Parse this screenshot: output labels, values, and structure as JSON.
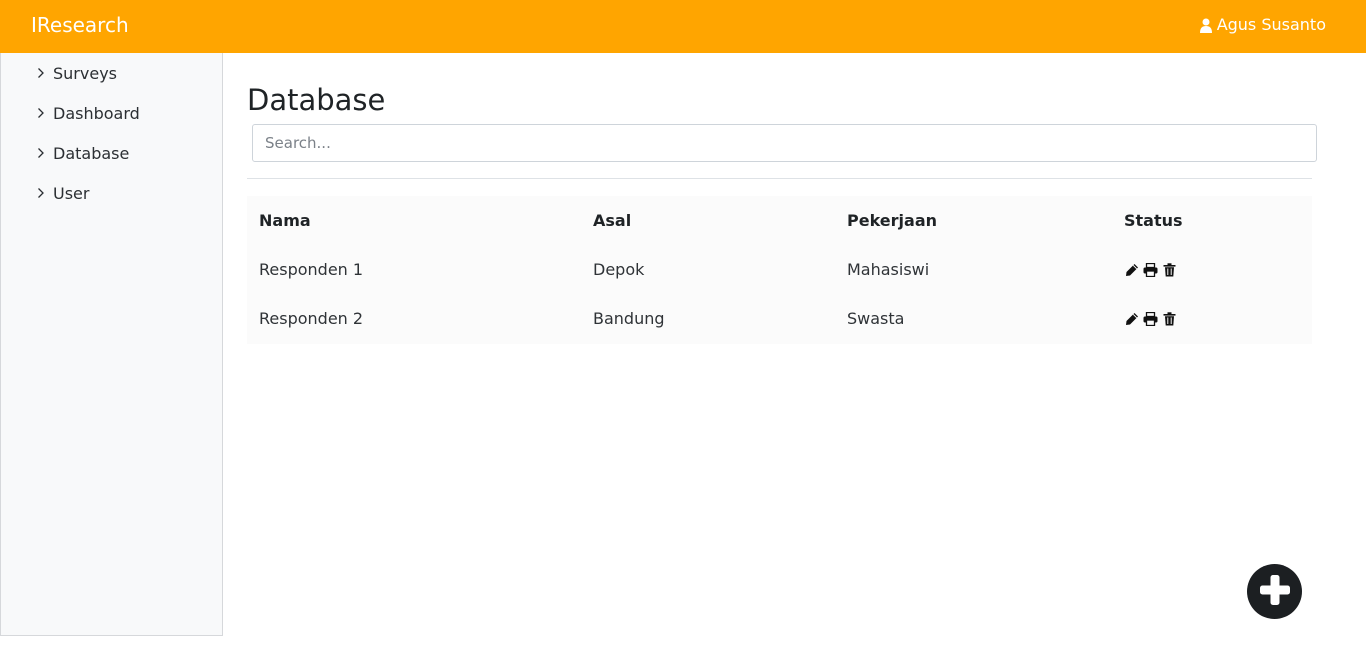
{
  "app": {
    "brand": "IResearch",
    "user_name": "Agus Susanto"
  },
  "sidebar": {
    "items": [
      {
        "label": "Surveys"
      },
      {
        "label": "Dashboard"
      },
      {
        "label": "Database"
      },
      {
        "label": "User"
      }
    ]
  },
  "page": {
    "title": "Database"
  },
  "search": {
    "placeholder": "Search..."
  },
  "table": {
    "headers": [
      "Nama",
      "Asal",
      "Pekerjaan",
      "Status"
    ],
    "rows": [
      {
        "nama": "Responden 1",
        "asal": "Depok",
        "pekerjaan": "Mahasiswi",
        "actions": [
          "pencil-icon",
          "print-icon",
          "trash-icon"
        ]
      },
      {
        "nama": "Responden 2",
        "asal": "Bandung",
        "pekerjaan": "Swasta",
        "actions": [
          "pencil-icon",
          "print-icon",
          "trash-icon"
        ]
      }
    ]
  },
  "fab": {
    "icon": "plus-icon"
  },
  "colors": {
    "header_bg": "#ffa500",
    "sidebar_bg": "#f8f9fa",
    "fab_bg": "#1c1f22"
  }
}
